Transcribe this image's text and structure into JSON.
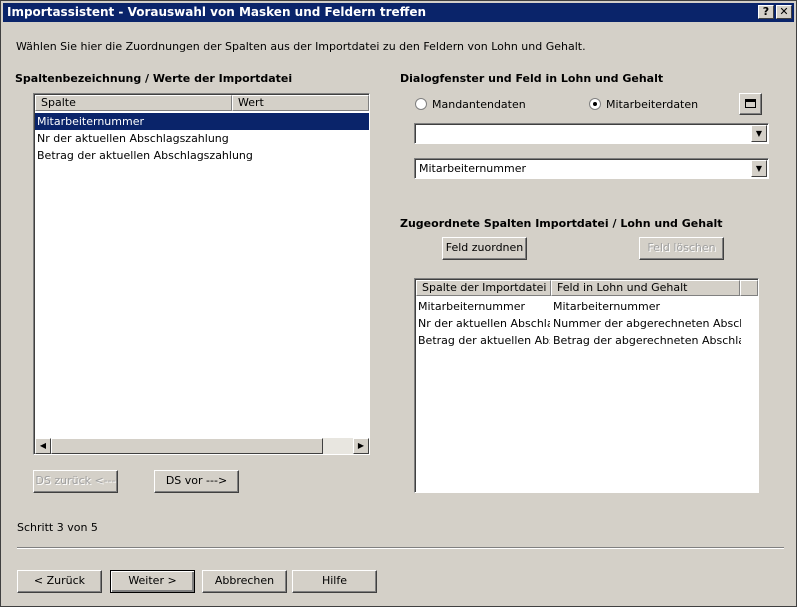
{
  "window": {
    "title": "Importassistent - Vorauswahl von Masken und Feldern treffen",
    "help_label": "?",
    "close_label": "✕"
  },
  "intro": "Wählen Sie hier die Zuordnungen der Spalten aus der Importdatei zu den Feldern von Lohn und Gehalt.",
  "left": {
    "heading": "Spaltenbezeichnung / Werte der Importdatei",
    "col_spalte": "Spalte",
    "col_wert": "Wert",
    "rows": [
      "Mitarbeiternummer",
      "Nr der aktuellen Abschlagszahlung",
      "Betrag der aktuellen Abschlagszahlung"
    ],
    "btn_back": "DS zurück <---",
    "btn_fwd": "DS vor --->"
  },
  "right": {
    "heading": "Dialogfenster und Feld in Lohn und Gehalt",
    "radio_mandant": "Mandantendaten",
    "radio_mitarbeiter": "Mitarbeiterdaten",
    "combo1_value": "",
    "combo2_value": "Mitarbeiternummer",
    "mapped_heading": "Zugeordnete Spalten Importdatei / Lohn und Gehalt",
    "btn_assign": "Feld zuordnen",
    "btn_delete": "Feld löschen",
    "col_import": "Spalte der Importdatei",
    "col_lohn": "Feld in Lohn und Gehalt",
    "mapped_rows": [
      {
        "import": "Mitarbeiternummer",
        "lohn": "Mitarbeiternummer"
      },
      {
        "import": "Nr der aktuellen Abschla...",
        "lohn": "Nummer der abgerechneten Abschla..."
      },
      {
        "import": "Betrag der aktuellen Abs...",
        "lohn": "Betrag der abgerechneten Abschlag..."
      }
    ]
  },
  "step": "Schritt 3 von 5",
  "footer": {
    "back": "< Zurück",
    "next": "Weiter >",
    "cancel": "Abbrechen",
    "help": "Hilfe"
  }
}
